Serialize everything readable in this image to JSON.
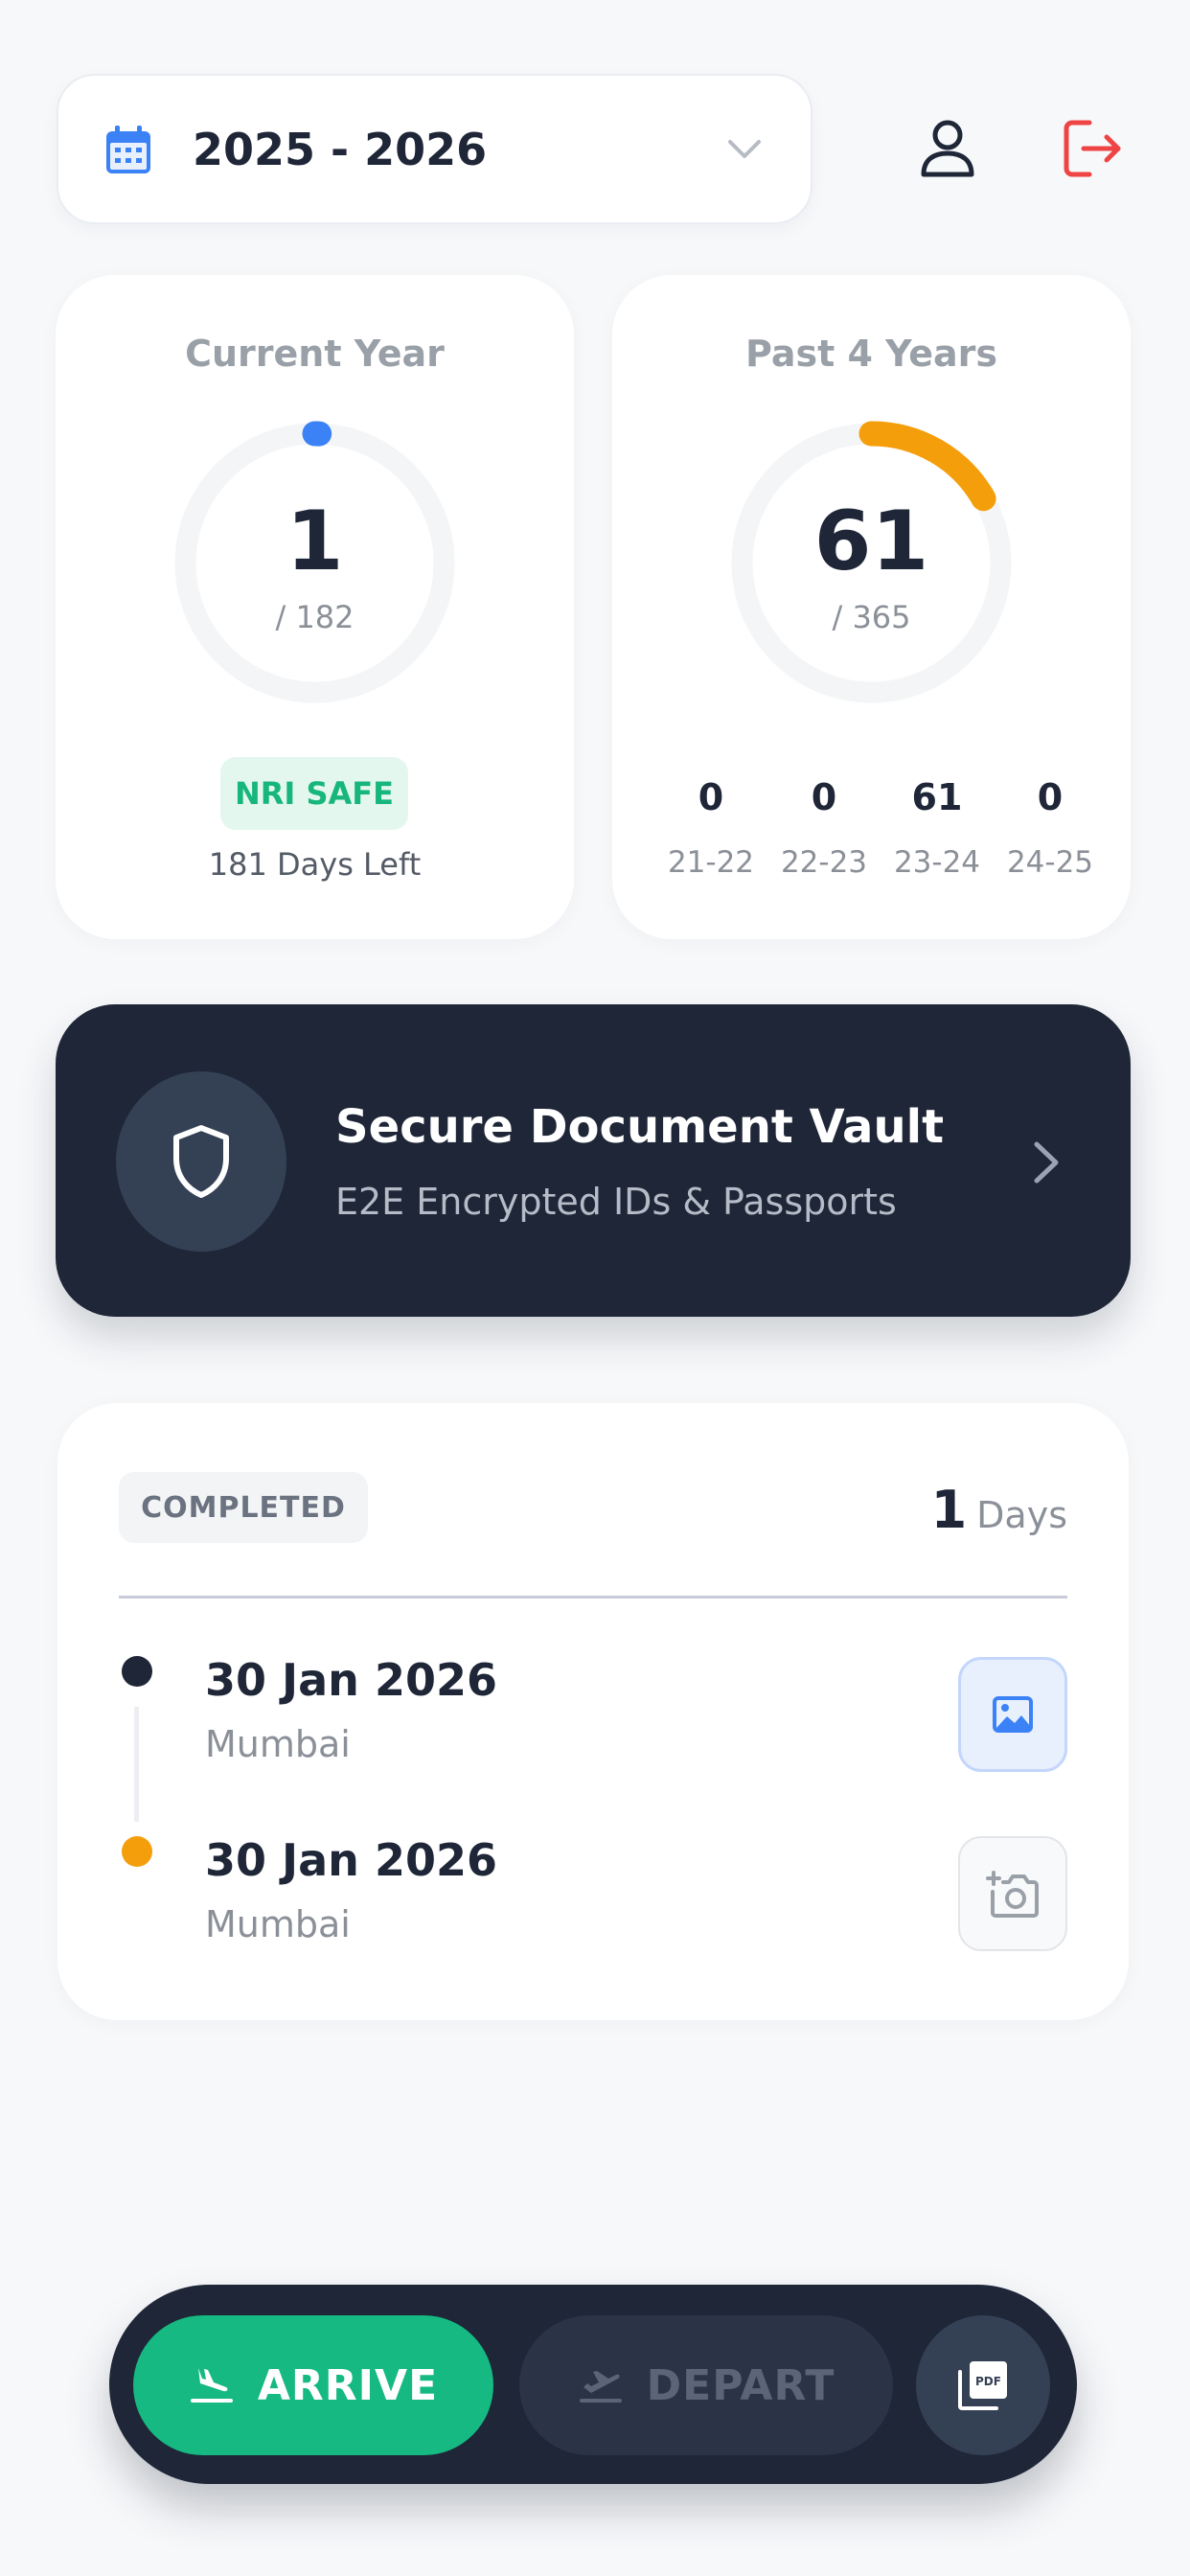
{
  "header": {
    "year_range": "2025 - 2026",
    "icons": [
      "calendar-icon",
      "chevron-down-icon",
      "user-icon",
      "logout-icon"
    ],
    "logout_color": "#ef4444",
    "calendar_color": "#3b82f6"
  },
  "current_year": {
    "title": "Current Year",
    "value": "1",
    "limit": "/ 182",
    "progress": 0.0055,
    "ring_color": "#3b82f6",
    "status": "NRI SAFE",
    "status_color": "#17b67c",
    "days_left": "181 Days Left"
  },
  "past_years": {
    "title": "Past 4 Years",
    "value": "61",
    "limit": "/ 365",
    "progress": 0.167,
    "ring_color": "#f59e0b",
    "years": [
      {
        "value": "0",
        "label": "21-22"
      },
      {
        "value": "0",
        "label": "22-23"
      },
      {
        "value": "61",
        "label": "23-24"
      },
      {
        "value": "0",
        "label": "24-25"
      }
    ]
  },
  "vault": {
    "title": "Secure Document Vault",
    "subtitle": "E2E Encrypted IDs & Passports"
  },
  "trip": {
    "status": "COMPLETED",
    "days": "1",
    "days_unit": "Days",
    "entries": [
      {
        "date": "30 Jan 2026",
        "place": "Mumbai",
        "dot_color": "#1e2637",
        "action": "photo-icon"
      },
      {
        "date": "30 Jan 2026",
        "place": "Mumbai",
        "dot_color": "#f59e0b",
        "action": "add-photo-icon"
      }
    ]
  },
  "bottom_bar": {
    "arrive_label": "ARRIVE",
    "depart_label": "DEPART",
    "pdf_label": "PDF",
    "arrive_color": "#15b981"
  }
}
